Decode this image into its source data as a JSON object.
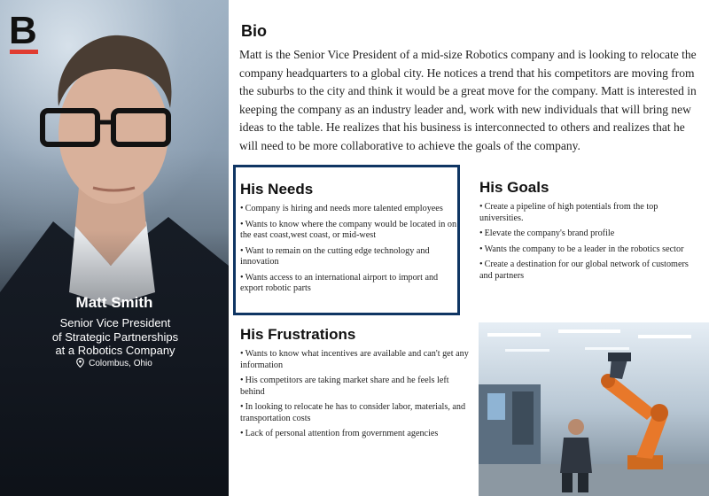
{
  "logo": {
    "letter": "B"
  },
  "profile": {
    "name": "Matt Smith",
    "title_lines": [
      "Senior Vice President",
      "of Strategic Partnerships",
      "at a Robotics Company"
    ],
    "location": "Colombus, Ohio"
  },
  "bio": {
    "heading": "Bio",
    "text": "Matt is the Senior Vice President of a mid-size Robotics company and is looking to relocate the company headquarters to a global city. He notices a trend that his competitors are moving from the suburbs to the city and think it would be a great move for the company. Matt is interested in keeping the company as an industry leader and, work with new individuals that will bring new ideas to the table. He realizes that his business is interconnected to others and realizes that he will need to be more collaborative to achieve the goals of the company."
  },
  "needs": {
    "heading": "His Needs",
    "items": [
      "Company is hiring and needs more talented employees",
      "Wants to know where the company would be located in on the east coast,west coast, or mid-west",
      "Want to remain on the cutting edge technology and innovation",
      "Wants access to an international airport to import and export robotic parts"
    ]
  },
  "goals": {
    "heading": "His Goals",
    "items": [
      "Create a pipeline of high potentials from the top universities.",
      "Elevate the company's brand profile",
      "Wants the company to be a leader in the robotics sector",
      "Create a destination for our global network of customers and partners"
    ]
  },
  "frustrations": {
    "heading": "His Frustrations",
    "items": [
      "Wants to know what incentives are available and can't get any information",
      "His competitors are taking market share and he feels left behind",
      "In looking to relocate he has to consider labor, materials, and transportation costs",
      "Lack of personal attention from government agencies"
    ]
  },
  "colors": {
    "brand_red": "#e03c31",
    "needs_border": "#0f3563",
    "robot_orange": "#e8782a"
  },
  "icons": {
    "location": "map-pin-icon"
  }
}
